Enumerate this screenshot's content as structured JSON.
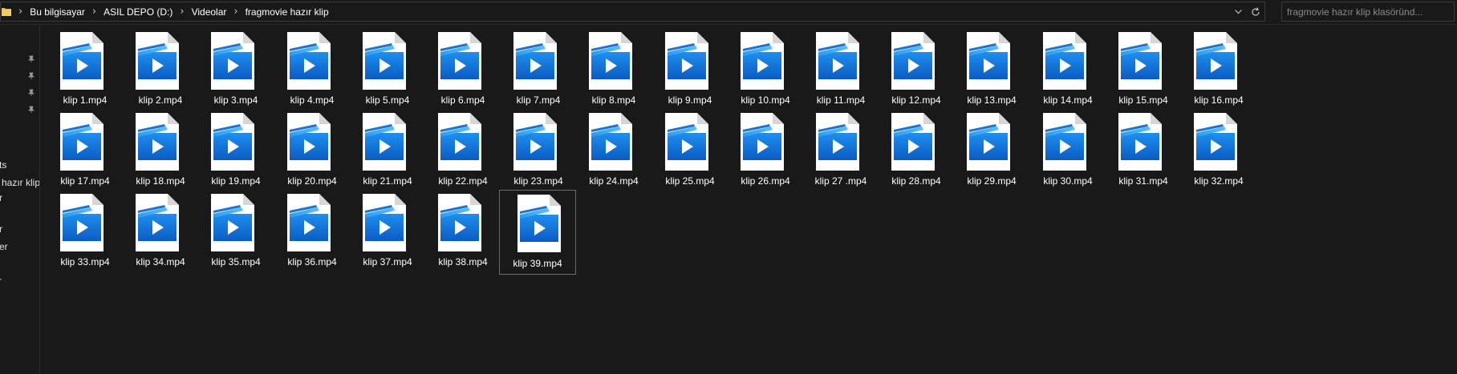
{
  "address_bar": {
    "breadcrumbs": [
      "Bu bilgisayar",
      "ASIL DEPO (D:)",
      "Videolar",
      "fragmovie hazır klip"
    ],
    "dropdown_icon": "chevron-down-icon",
    "refresh_icon": "refresh-icon"
  },
  "search": {
    "placeholder": "fragmovie hazır klip klasöründ..."
  },
  "nav_pane": {
    "partial_labels": [
      "ts",
      "hazır klip",
      "r",
      "er"
    ]
  },
  "colors": {
    "background": "#191919",
    "icon_blue_dark": "#0a5cc2",
    "icon_blue_light": "#2a9bf0",
    "selection_border": "#6b6b6b"
  },
  "files": [
    {
      "name": "klip 1.mp4"
    },
    {
      "name": "klip 2.mp4"
    },
    {
      "name": "klip 3.mp4"
    },
    {
      "name": "klip 4.mp4"
    },
    {
      "name": "klip 5.mp4"
    },
    {
      "name": "klip 6.mp4"
    },
    {
      "name": "klip 7.mp4"
    },
    {
      "name": "klip 8.mp4"
    },
    {
      "name": "klip 9.mp4"
    },
    {
      "name": "klip 10.mp4"
    },
    {
      "name": "klip 11.mp4"
    },
    {
      "name": "klip 12.mp4"
    },
    {
      "name": "klip 13.mp4"
    },
    {
      "name": "klip 14.mp4"
    },
    {
      "name": "klip 15.mp4"
    },
    {
      "name": "klip 16.mp4"
    },
    {
      "name": "klip 17.mp4"
    },
    {
      "name": "klip 18.mp4"
    },
    {
      "name": "klip 19.mp4"
    },
    {
      "name": "klip 20.mp4"
    },
    {
      "name": "klip 21.mp4"
    },
    {
      "name": "klip 22.mp4"
    },
    {
      "name": "klip 23.mp4"
    },
    {
      "name": "klip 24.mp4"
    },
    {
      "name": "klip 25.mp4"
    },
    {
      "name": "klip 26.mp4"
    },
    {
      "name": "klip 27 .mp4"
    },
    {
      "name": "klip 28.mp4"
    },
    {
      "name": "klip 29.mp4"
    },
    {
      "name": "klip 30.mp4"
    },
    {
      "name": "klip 31.mp4"
    },
    {
      "name": "klip 32.mp4"
    },
    {
      "name": "klip 33.mp4"
    },
    {
      "name": "klip 34.mp4"
    },
    {
      "name": "klip 35.mp4"
    },
    {
      "name": "klip 36.mp4"
    },
    {
      "name": "klip 37.mp4"
    },
    {
      "name": "klip 38.mp4"
    },
    {
      "name": "klip 39.mp4",
      "selected": true
    }
  ],
  "file_icon": "video-file-icon"
}
